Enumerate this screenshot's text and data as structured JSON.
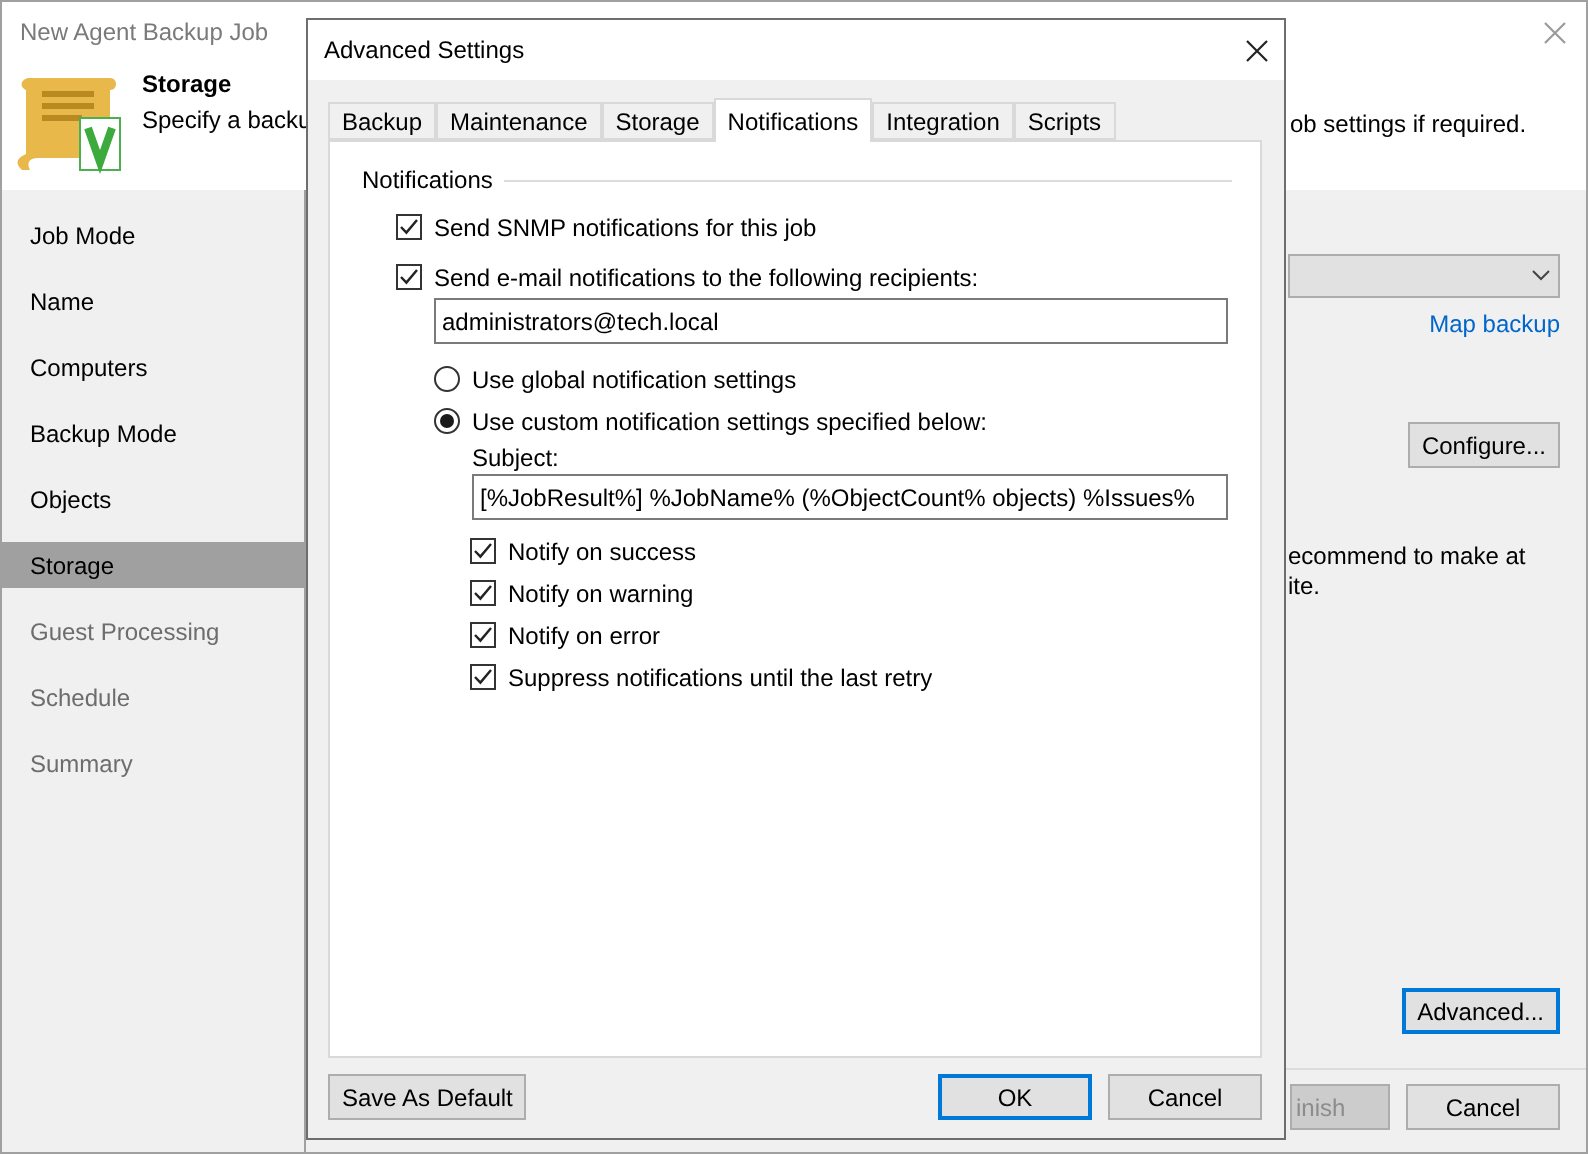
{
  "window": {
    "title": "New Agent Backup Job"
  },
  "header": {
    "title": "Storage",
    "description_parts": [
      "Specify a backu",
      "ob settings if required."
    ]
  },
  "sidebar": {
    "items": [
      {
        "label": "Job Mode",
        "selected": false,
        "disabled": false
      },
      {
        "label": "Name",
        "selected": false,
        "disabled": false
      },
      {
        "label": "Computers",
        "selected": false,
        "disabled": false
      },
      {
        "label": "Backup Mode",
        "selected": false,
        "disabled": false
      },
      {
        "label": "Objects",
        "selected": false,
        "disabled": false
      },
      {
        "label": "Storage",
        "selected": true,
        "disabled": false
      },
      {
        "label": "Guest Processing",
        "selected": false,
        "disabled": true
      },
      {
        "label": "Schedule",
        "selected": false,
        "disabled": true
      },
      {
        "label": "Summary",
        "selected": false,
        "disabled": true
      }
    ]
  },
  "content": {
    "link": "Map backup",
    "configure_button": "Configure...",
    "note_lines": [
      "ecommend to make at",
      "ite."
    ],
    "advanced_button": {
      "label": "Advanced...",
      "focused": true
    }
  },
  "footer_buttons": [
    {
      "label": "inish",
      "disabled": true
    },
    {
      "label": "Cancel",
      "disabled": false
    }
  ],
  "dialog": {
    "title": "Advanced Settings",
    "tabs": [
      {
        "label": "Backup",
        "selected": false
      },
      {
        "label": "Maintenance",
        "selected": false
      },
      {
        "label": "Storage",
        "selected": false
      },
      {
        "label": "Notifications",
        "selected": true
      },
      {
        "label": "Integration",
        "selected": false
      },
      {
        "label": "Scripts",
        "selected": false
      }
    ],
    "group_title": "Notifications",
    "snmp": {
      "label": "Send SNMP notifications for this job",
      "checked": true
    },
    "email": {
      "label": "Send e-mail notifications to the following recipients:",
      "checked": true,
      "recipients": "administrators@tech.local"
    },
    "notification_mode": [
      {
        "label": "Use global notification settings",
        "selected": false
      },
      {
        "label": "Use custom notification settings specified below:",
        "selected": true
      }
    ],
    "subject": {
      "label": "Subject:",
      "value": "[%JobResult%] %JobName% (%ObjectCount% objects) %Issues%"
    },
    "notify_options": [
      {
        "label": "Notify on success",
        "checked": true
      },
      {
        "label": "Notify on warning",
        "checked": true
      },
      {
        "label": "Notify on error",
        "checked": true
      },
      {
        "label": "Suppress notifications until the last retry",
        "checked": true
      }
    ],
    "buttons": [
      {
        "label": "Save As Default",
        "focused": false
      },
      {
        "label": "OK",
        "focused": true
      },
      {
        "label": "Cancel",
        "focused": false
      }
    ]
  }
}
